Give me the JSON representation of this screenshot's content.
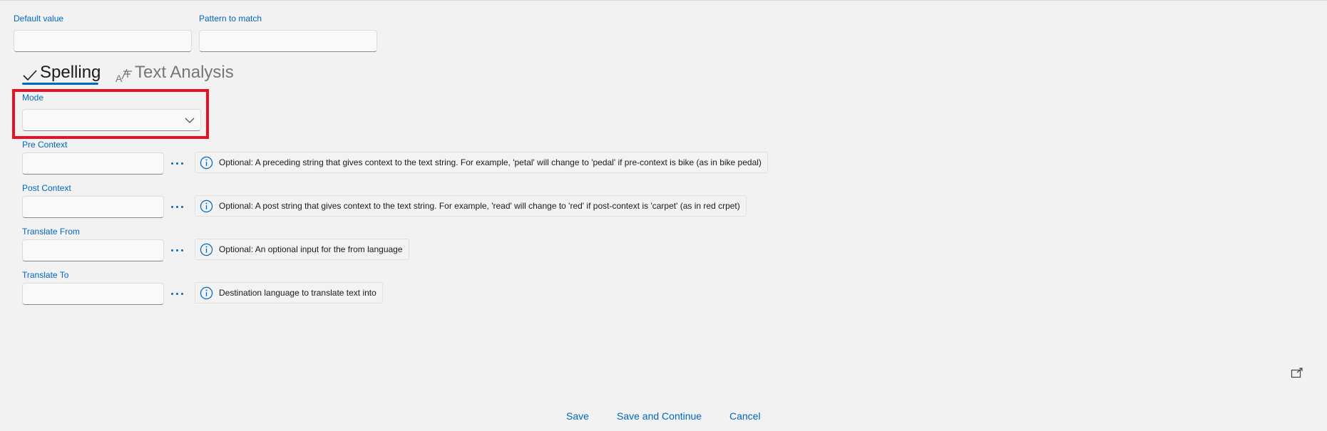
{
  "form": {
    "default_value": {
      "label": "Default value",
      "value": "",
      "placeholder": ""
    },
    "pattern_to_match": {
      "label": "Pattern to match",
      "value": "",
      "placeholder": ""
    }
  },
  "tabs": [
    {
      "label": "Spelling",
      "icon": "checkmark-icon",
      "active": true
    },
    {
      "label": "Text Analysis",
      "icon": "text-analysis-icon",
      "active": false
    }
  ],
  "spelling": {
    "mode": {
      "label": "Mode",
      "selected": ""
    },
    "fields": [
      {
        "label": "Pre Context",
        "value": "",
        "info": "Optional: A preceding string that gives context to the text string. For example, 'petal' will change to 'pedal' if pre-context is bike (as in bike pedal)"
      },
      {
        "label": "Post Context",
        "value": "",
        "info": "Optional: A post string that gives context to the text string. For example, 'read' will change to 'red' if post-context is 'carpet' (as in red crpet)"
      },
      {
        "label": "Translate From",
        "value": "",
        "info": "Optional: An optional input for the from language"
      },
      {
        "label": "Translate To",
        "value": "",
        "info": "Destination language to translate text into"
      }
    ]
  },
  "footer": {
    "save_label": "Save",
    "save_continue_label": "Save and Continue",
    "cancel_label": "Cancel"
  },
  "colors": {
    "accent": "#0067c0",
    "highlight": "#e81123",
    "background": "#f2f2f2"
  }
}
